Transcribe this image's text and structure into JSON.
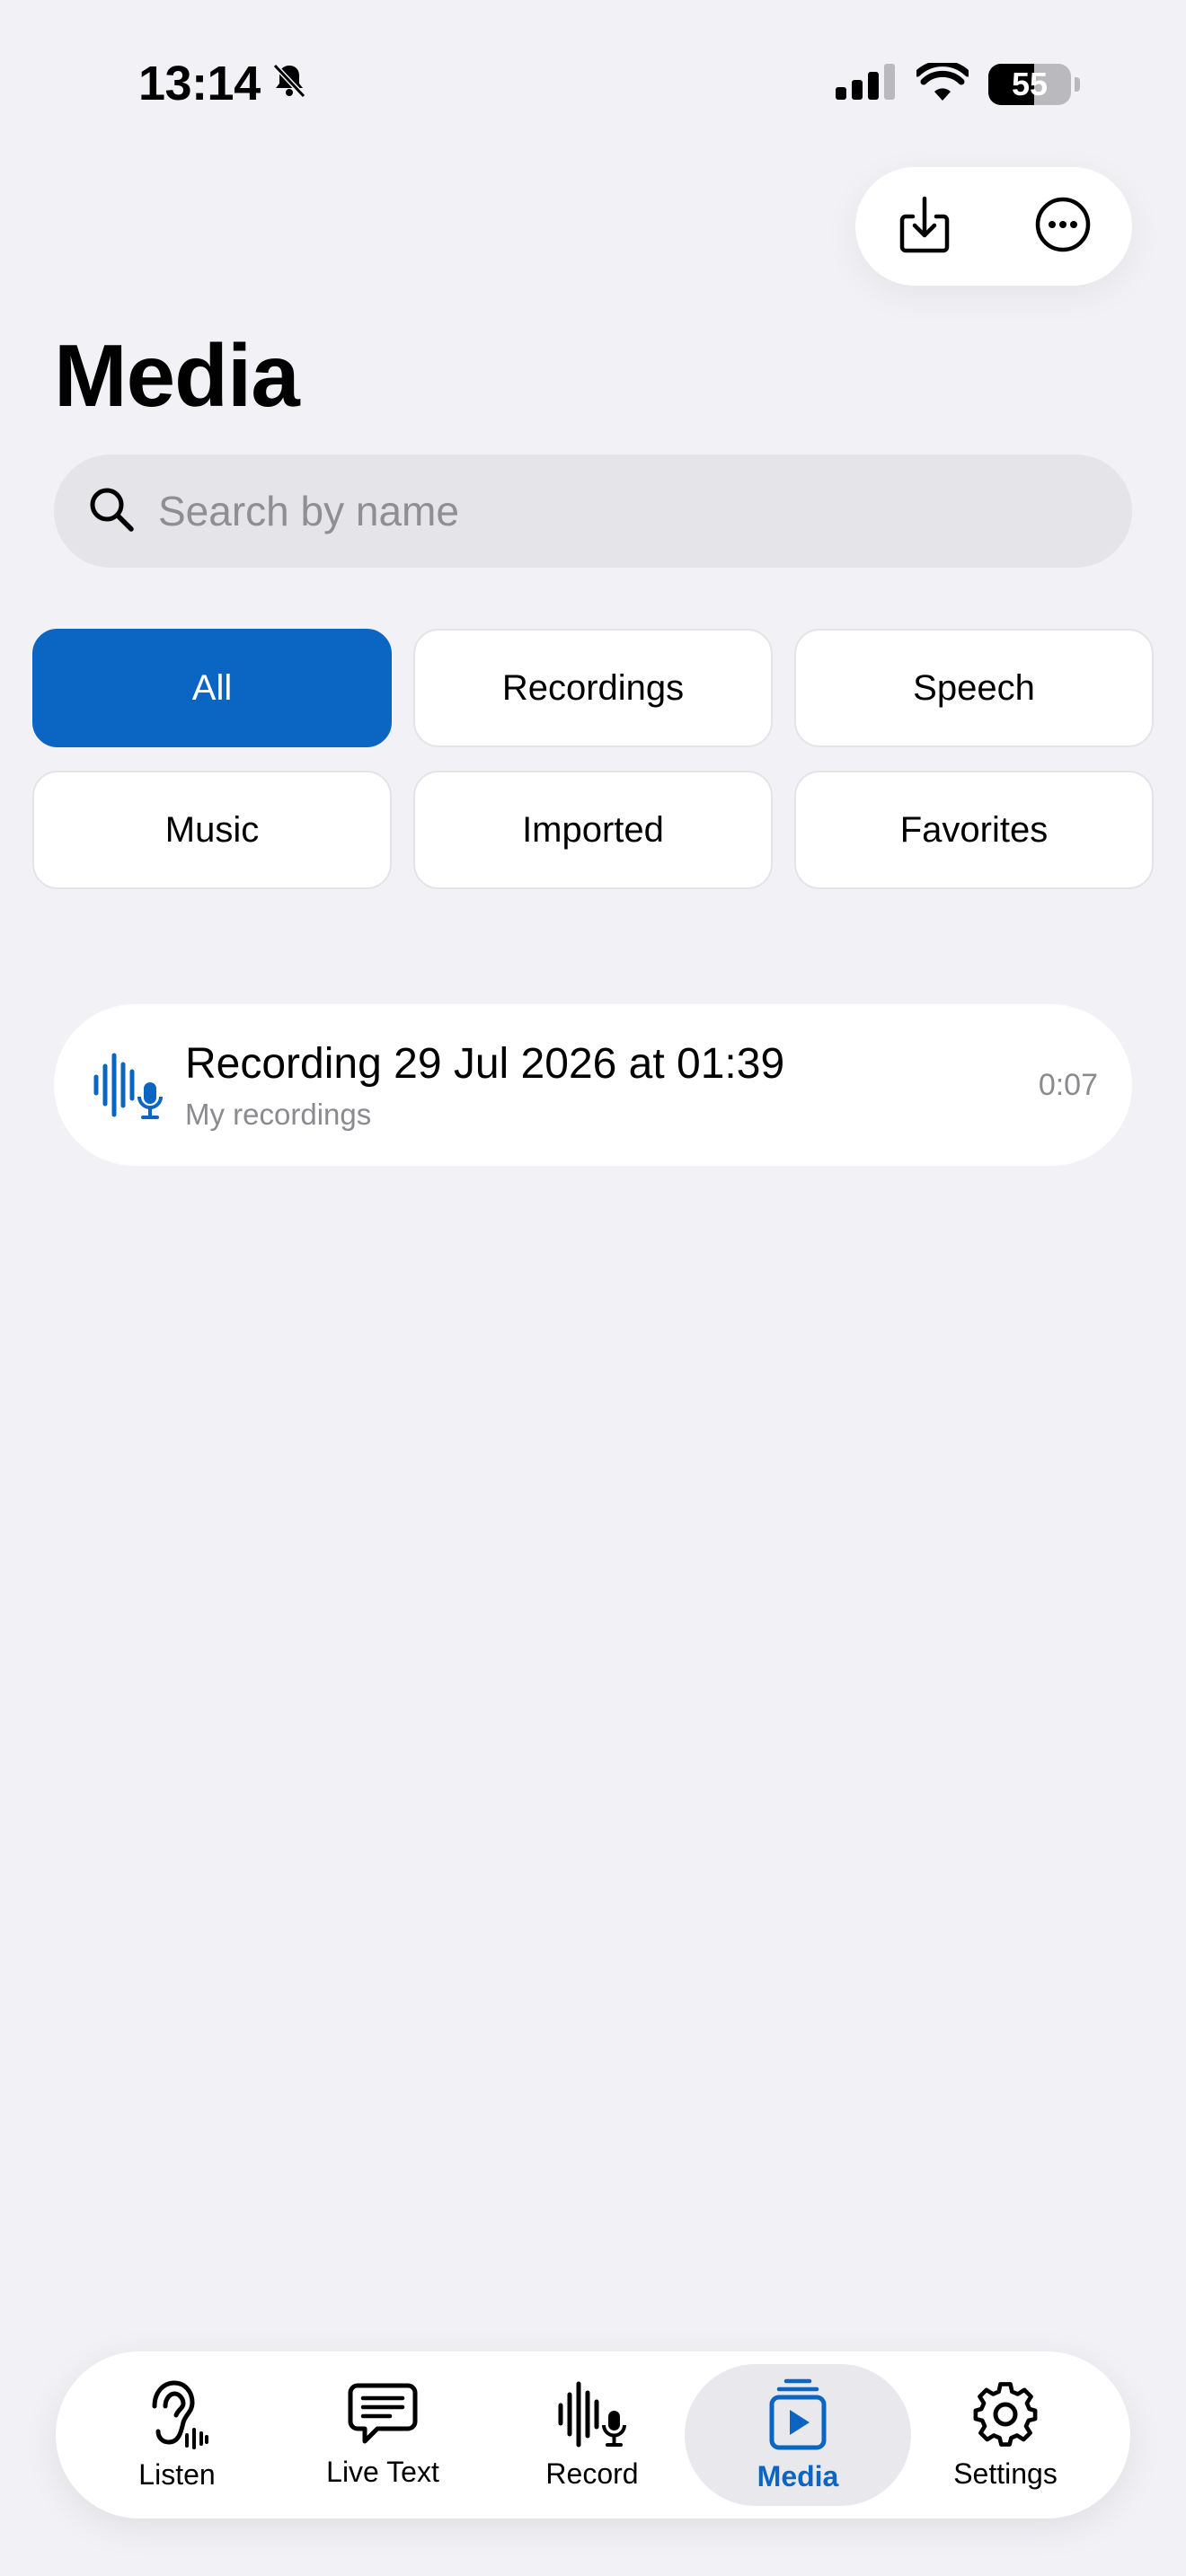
{
  "status_bar": {
    "time": "13:14",
    "battery": "55",
    "icons": [
      "bell-slash-icon",
      "cellular-signal-icon",
      "wifi-icon",
      "battery-icon"
    ]
  },
  "top_actions": {
    "icons": [
      "import-icon",
      "more-icon"
    ]
  },
  "page": {
    "title": "Media"
  },
  "search": {
    "placeholder": "Search by name",
    "value": ""
  },
  "filters": {
    "selected": "All",
    "items": [
      "All",
      "Recordings",
      "Speech",
      "Music",
      "Imported",
      "Favorites"
    ]
  },
  "recordings": [
    {
      "title": "Recording 29 Jul 2026 at 01:39",
      "subtitle": "My recordings",
      "duration": "0:07",
      "icon": "waveform-mic-icon"
    }
  ],
  "tabbar": {
    "selected": "Media",
    "items": [
      {
        "label": "Listen",
        "icon": "ear-icon"
      },
      {
        "label": "Live Text",
        "icon": "speech-bubble-icon"
      },
      {
        "label": "Record",
        "icon": "waveform-mic-icon"
      },
      {
        "label": "Media",
        "icon": "media-play-icon"
      },
      {
        "label": "Settings",
        "icon": "gear-icon"
      }
    ]
  },
  "colors": {
    "accent": "#0b66c3",
    "background": "#f1f1f6",
    "card": "#ffffff",
    "secondary_text": "#8a8a8f"
  }
}
